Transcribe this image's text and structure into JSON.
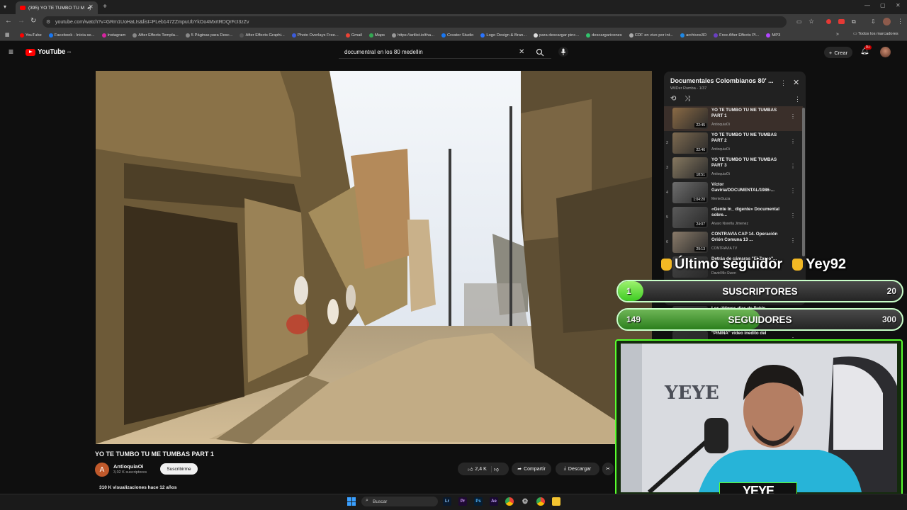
{
  "browser": {
    "tab_title": "(395) YO TE TUMBO TU M",
    "url": "youtube.com/watch?v=GRm1UoHaLIs&list=PLeb147ZZmpuUbYkOo4MxrtRDQrFcI3zZv",
    "bookmarks": [
      "YouTube",
      "Facebook - Inicia se...",
      "Instagram",
      "After Effects Templa...",
      "5 Páginas para Desc...",
      "After Effects Graphi...",
      "Photo Overlays Free...",
      "Gmail",
      "Maps",
      "https://artlist.io/tha...",
      "Creator Studio",
      "Logo Design & Bran...",
      "para descargar pinc...",
      "descargaricones",
      "CDF en vivo por int...",
      "archivos3D",
      "Free After Effects Pl...",
      "MP3"
    ],
    "bookmarks_folder": "Todos los marcadores"
  },
  "youtube": {
    "logo_text": "YouTube",
    "logo_country": "ES",
    "search_value": "documentral en los 80 medellin",
    "create_label": "Crear",
    "notif_count": "9+"
  },
  "video": {
    "title": "YO TE TUMBO TU ME TUMBAS PART 1",
    "channel": "AntioquiaOi",
    "channel_initial": "A",
    "subscribers": "3,02 K suscriptores",
    "subscribe_label": "Suscribirme",
    "likes": "2,4 K",
    "share_label": "Compartir",
    "download_label": "Descargar",
    "views_line": "310 K visualizaciones  hace 12 años"
  },
  "playlist": {
    "title": "Documentales Colombianos 80' ...",
    "subtitle": "WilDer Rumba - 1/37",
    "items": [
      {
        "index": "",
        "title": "YO TE TUMBO TU ME TUMBAS PART 1",
        "channel": "AntioquiaOi",
        "duration": "22:45"
      },
      {
        "index": "2",
        "title": "YO TE TUMBO TU ME TUMBAS PART 2",
        "channel": "AntioquiaOi",
        "duration": "22:46"
      },
      {
        "index": "3",
        "title": "YO TE TUMBO TU ME TUMBAS PART 3",
        "channel": "AntioquiaOi",
        "duration": "18:51"
      },
      {
        "index": "4",
        "title": "Víctor Gaviria/DOCUMENTAL/1986-...",
        "channel": "MenteSucia",
        "duration": "1:04:20"
      },
      {
        "index": "5",
        "title": "«Gente In_ digente» Documental sobre...",
        "channel": "Alvaro Noreña Jimenez",
        "duration": "24:07"
      },
      {
        "index": "6",
        "title": "CONTRAVÍA CAP 14. Operación Orión Comuna 13 ...",
        "channel": "CONTRAVIA TV",
        "duration": "29:13"
      },
      {
        "index": "7",
        "title": "Detrás de cámaras \"El Zarco\"...",
        "channel": "David Mc Ewen",
        "duration": ""
      },
      {
        "index": "8",
        "title": "¿Cómo fue la caída de Pablo Escobar?...",
        "channel": "Discovery Channel",
        "duration": "47:42"
      },
      {
        "index": "9",
        "title": "Los últimos días de Pablo ...",
        "channel": "",
        "duration": ""
      },
      {
        "index": "10",
        "title": "\"PININA\" video inedito del",
        "channel": "",
        "duration": ""
      }
    ]
  },
  "overlay": {
    "last_follower_label": "Último seguidor",
    "last_follower_name": "Yey92",
    "subs_bar": {
      "left": "1",
      "label": "SUSCRIPTORES",
      "right": "20",
      "progress": 0.05
    },
    "followers_bar": {
      "left": "149",
      "label": "SEGUIDORES",
      "right": "300",
      "progress": 0.5
    },
    "streamer_name": "YEYE"
  },
  "taskbar": {
    "search_placeholder": "Buscar",
    "apps": [
      "Lr",
      "Pr",
      "Ps",
      "Ae"
    ]
  },
  "colors": {
    "youtube_red": "#ff0000",
    "overlay_green": "#59ff2e"
  }
}
